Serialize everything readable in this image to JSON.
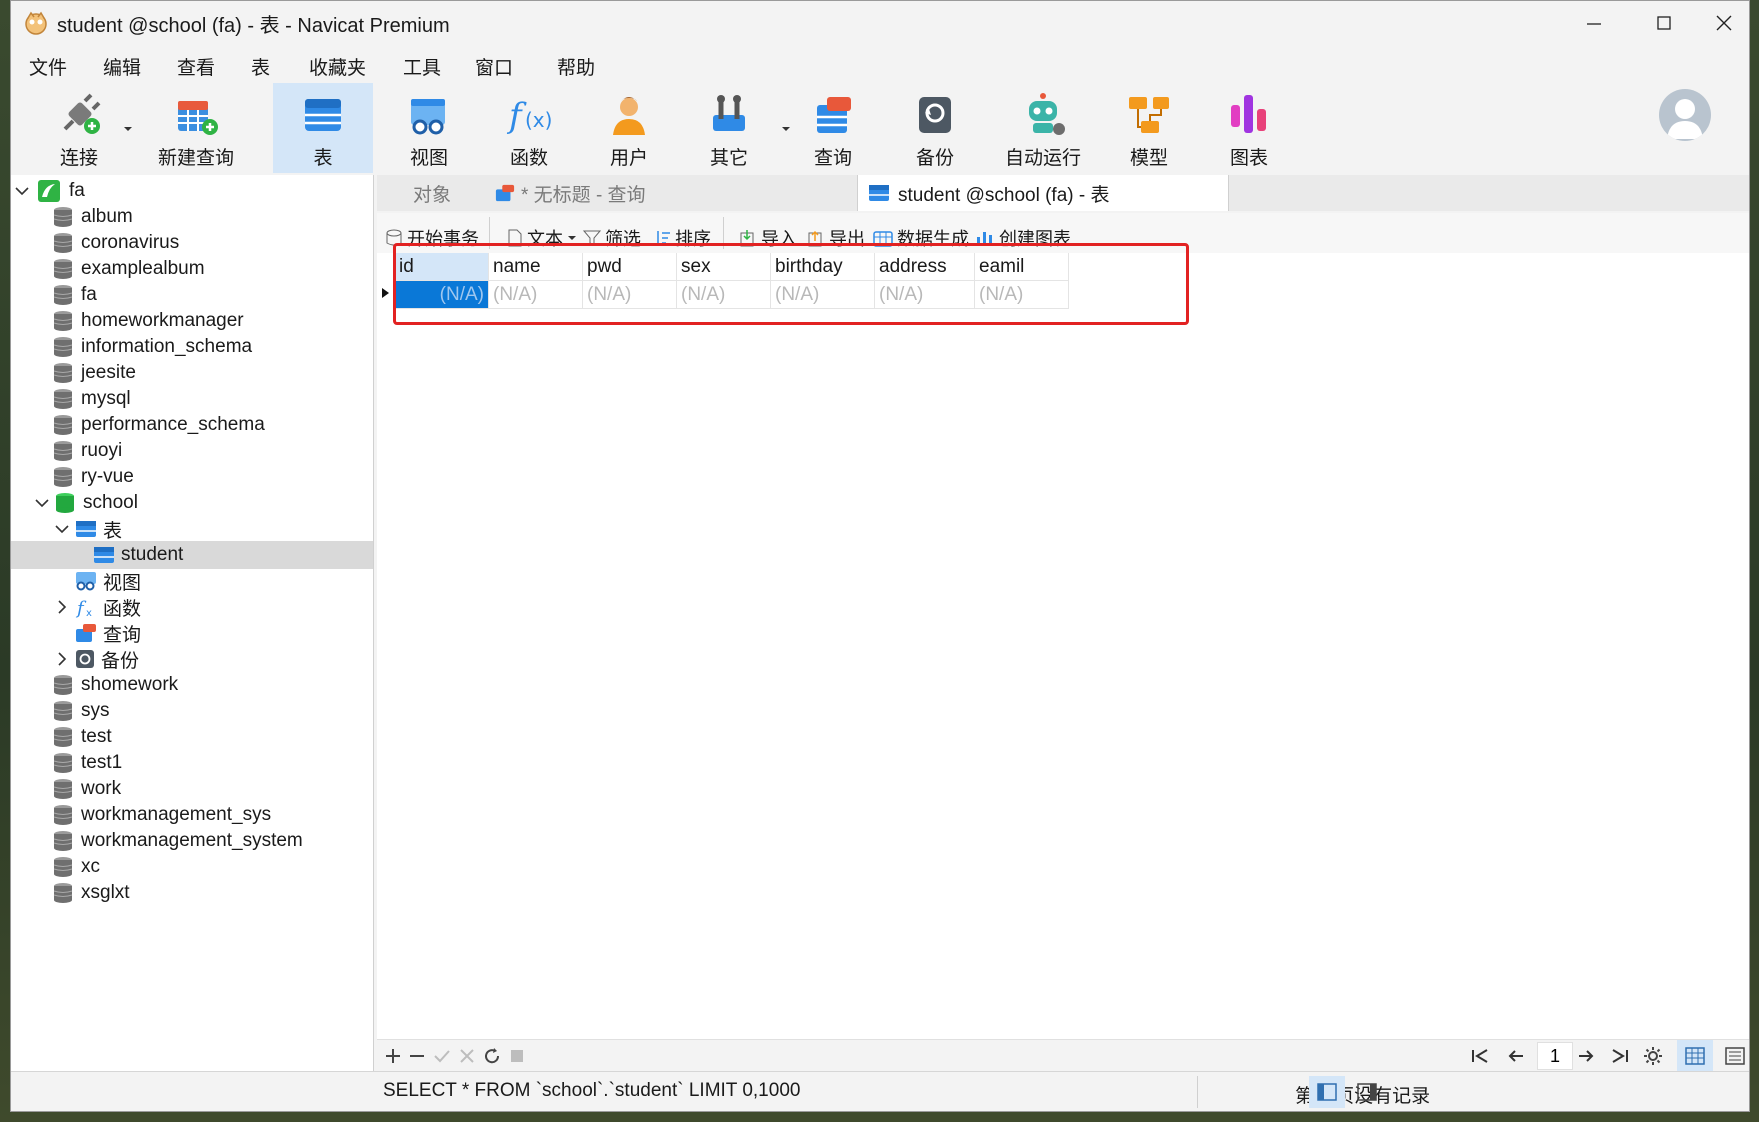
{
  "window": {
    "title": "student @school (fa) - 表 - Navicat Premium"
  },
  "menu": [
    "文件",
    "编辑",
    "查看",
    "表",
    "收藏夹",
    "工具",
    "窗口",
    "帮助"
  ],
  "toolbar": [
    {
      "label": "连接",
      "icon": "connect-icon"
    },
    {
      "label": "新建查询",
      "icon": "new-query-icon"
    },
    {
      "label": "表",
      "icon": "table-icon",
      "active": true
    },
    {
      "label": "视图",
      "icon": "view-icon"
    },
    {
      "label": "函数",
      "icon": "function-icon"
    },
    {
      "label": "用户",
      "icon": "user-icon"
    },
    {
      "label": "其它",
      "icon": "tools-icon"
    },
    {
      "label": "查询",
      "icon": "query-icon"
    },
    {
      "label": "备份",
      "icon": "backup-icon"
    },
    {
      "label": "自动运行",
      "icon": "robot-icon"
    },
    {
      "label": "模型",
      "icon": "model-icon"
    },
    {
      "label": "图表",
      "icon": "chart-icon"
    }
  ],
  "tree": {
    "connection": "fa",
    "databases_before": [
      "album",
      "coronavirus",
      "examplealbum",
      "fa",
      "homeworkmanager",
      "information_schema",
      "jeesite",
      "mysql",
      "performance_schema",
      "ruoyi",
      "ry-vue"
    ],
    "open_db": "school",
    "school_children": {
      "tables_label": "表",
      "table": "student",
      "views_label": "视图",
      "functions_label": "函数",
      "queries_label": "查询",
      "backups_label": "备份"
    },
    "databases_after": [
      "shomework",
      "sys",
      "test",
      "test1",
      "work",
      "workmanagement_sys",
      "workmanagement_system",
      "xc",
      "xsglxt"
    ]
  },
  "tabs": {
    "objects": "对象",
    "untitled_query": "* 无标题 - 查询",
    "active": "student @school (fa) - 表"
  },
  "subtoolbar": {
    "begin_transaction": "开始事务",
    "text": "文本",
    "filter": "筛选",
    "sort": "排序",
    "import": "导入",
    "export": "导出",
    "data_generation": "数据生成",
    "create_chart": "创建图表"
  },
  "grid": {
    "columns": [
      "id",
      "name",
      "pwd",
      "sex",
      "birthday",
      "address",
      "eamil"
    ],
    "row": [
      "(N/A)",
      "(N/A)",
      "(N/A)",
      "(N/A)",
      "(N/A)",
      "(N/A)",
      "(N/A)"
    ]
  },
  "pager": {
    "page": "1"
  },
  "status": {
    "sql": "SELECT * FROM `school`.`student` LIMIT 0,1000",
    "records": "第 1 页没有记录"
  },
  "colors": {
    "accent": "#0a78d7",
    "highlight": "#e22222",
    "selected_tab": "#d4e6f8"
  }
}
